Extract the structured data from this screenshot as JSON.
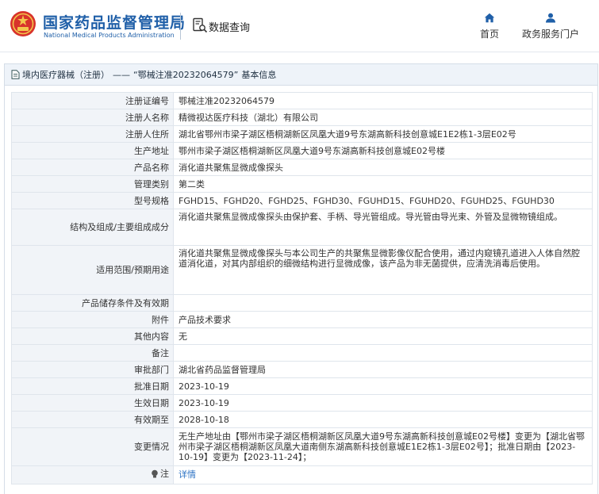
{
  "header": {
    "brand_cn": "国家药品监督管理局",
    "brand_en": "National Medical Products Administration",
    "query_label": "数据查询",
    "nav_home": "首页",
    "nav_gov": "政务服务门户"
  },
  "breadcrumb": {
    "section": "境内医疗器械（注册）",
    "separator": "——",
    "record": "“鄂械注准20232064579”",
    "suffix": "基本信息"
  },
  "fields": {
    "reg_no": {
      "label": "注册证编号",
      "value": "鄂械注准20232064579"
    },
    "registrant": {
      "label": "注册人名称",
      "value": "精微视达医疗科技（湖北）有限公司"
    },
    "address": {
      "label": "注册人住所",
      "value": "湖北省鄂州市梁子湖区梧桐湖新区凤凰大道9号东湖高新科技创意城E1E2栋1-3层E02号"
    },
    "production_address": {
      "label": "生产地址",
      "value": "鄂州市梁子湖区梧桐湖新区凤凰大道9号东湖高新科技创意城E02号楼"
    },
    "product_name": {
      "label": "产品名称",
      "value": "消化道共聚焦显微成像探头"
    },
    "category": {
      "label": "管理类别",
      "value": "第二类"
    },
    "models": {
      "label": "型号规格",
      "value": "FGHD15、FGHD20、FGHD25、FGHD30、FGUHD15、FGUHD20、FGUHD25、FGUHD30"
    },
    "structure": {
      "label": "结构及组成/主要组成成分",
      "value": "消化道共聚焦显微成像探头由保护套、手柄、导光管组成。导光管由导光束、外管及显微物镜组成。"
    },
    "scope": {
      "label": "适用范围/预期用途",
      "value": "消化道共聚焦显微成像探头与本公司生产的共聚焦显微影像仪配合使用，通过内窥镜孔道进入人体自然腔道消化道，对其内部组织的细微结构进行显微成像，该产品为非无菌提供，应清洗消毒后使用。"
    },
    "storage": {
      "label": "产品储存条件及有效期",
      "value": ""
    },
    "attachment": {
      "label": "附件",
      "value": "产品技术要求"
    },
    "other": {
      "label": "其他内容",
      "value": "无"
    },
    "remarks": {
      "label": "备注",
      "value": ""
    },
    "dept": {
      "label": "审批部门",
      "value": "湖北省药品监督管理局"
    },
    "approve_date": {
      "label": "批准日期",
      "value": "2023-10-19"
    },
    "effective_date": {
      "label": "生效日期",
      "value": "2023-10-19"
    },
    "expiry": {
      "label": "有效期至",
      "value": "2028-10-18"
    },
    "changes": {
      "label": "变更情况",
      "value": "无生产地址由【鄂州市梁子湖区梧桐湖新区凤凰大道9号东湖高新科技创意城E02号楼】变更为【湖北省鄂州市梁子湖区梧桐湖新区凤凰大道南侧东湖高新科技创意城E1E2栋1-3层E02号】；批准日期由【2023-10-19】变更为【2023-11-24】；"
    },
    "note": {
      "label": "注",
      "value": "详情"
    }
  },
  "colors": {
    "brand_blue": "#1f5fa8",
    "label_bg": "#f1f4f8",
    "breadcrumb_bg": "#eef3f9",
    "link": "#2d73c4"
  },
  "icons": {
    "logo": "nmpa-emblem-icon",
    "query": "document-search-icon",
    "home": "home-icon",
    "gov": "user-icon",
    "breadcrumb": "document-icon",
    "note": "lightbulb-icon"
  }
}
